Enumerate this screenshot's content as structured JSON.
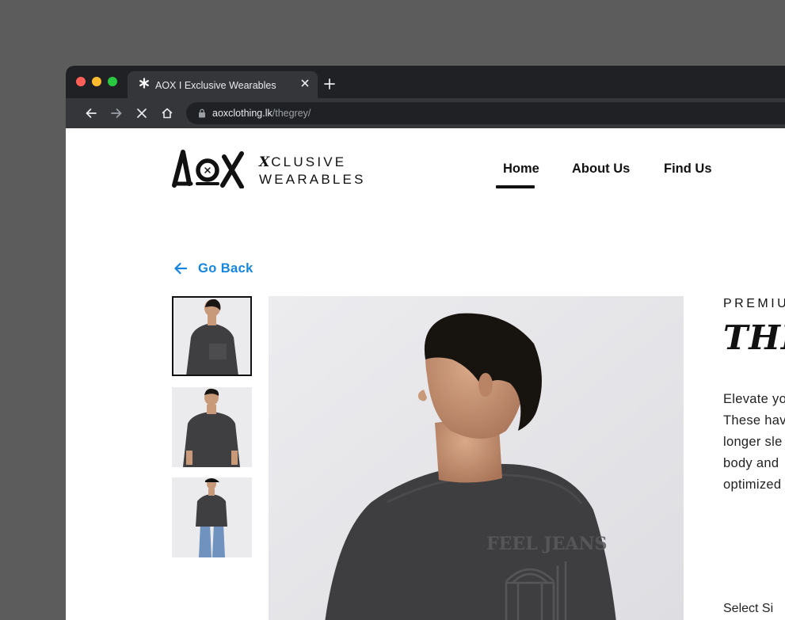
{
  "browser": {
    "tab_title": "AOX I Exclusive Wearables",
    "url_domain": "aoxclothing.lk",
    "url_path": "/thegrey/"
  },
  "site": {
    "logo_text": "AOX",
    "tagline_x": "X",
    "tagline_line1": "CLUSIVE",
    "tagline_line2": "WEARABLES",
    "nav": [
      {
        "label": "Home",
        "active": true
      },
      {
        "label": "About Us",
        "active": false
      },
      {
        "label": "Find Us",
        "active": false
      }
    ]
  },
  "product": {
    "back_label": "Go Back",
    "kicker": "PREMIU",
    "title": "THE",
    "description_lines": [
      "Elevate yo",
      "These hav",
      "longer sle",
      "body and",
      "optimized"
    ],
    "size_label": "Select Si",
    "thumbnails": [
      {
        "name": "back-view",
        "active": true
      },
      {
        "name": "front-view",
        "active": false
      },
      {
        "name": "full-body-view",
        "active": false
      }
    ]
  },
  "colors": {
    "accent": "#1486e0",
    "text": "#111111",
    "shirt": "#3f3f41",
    "background": "#ffffff"
  }
}
